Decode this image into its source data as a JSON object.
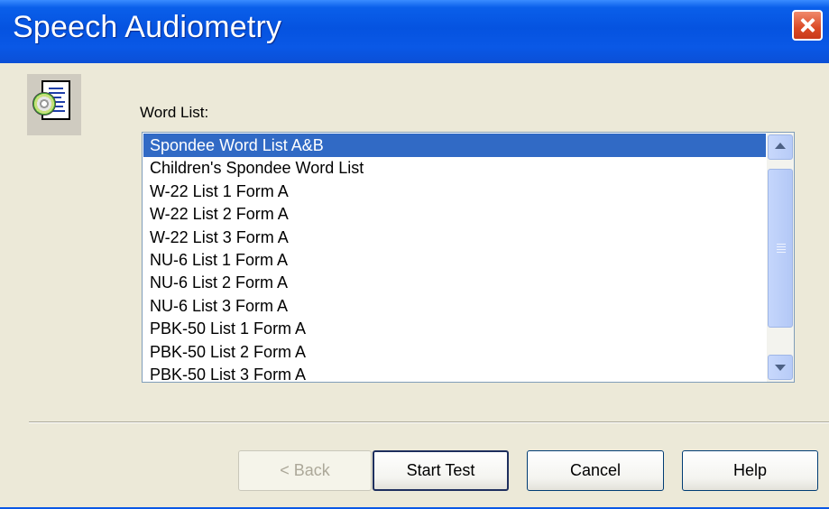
{
  "window": {
    "title": "Speech Audiometry"
  },
  "icons": {
    "dialog_icon": "document-with-disc-icon",
    "close_icon": "close-icon"
  },
  "word_list": {
    "label": "Word List:",
    "selected_index": 0,
    "items": [
      "Spondee Word List A&B",
      "Children's Spondee Word List",
      "W-22 List 1 Form A",
      "W-22 List 2 Form A",
      "W-22 List 3 Form A",
      "NU-6 List 1 Form A",
      "NU-6 List 2 Form A",
      "NU-6 List 3 Form A",
      "PBK-50 List 1 Form A",
      "PBK-50 List 2 Form A",
      "PBK-50 List 3 Form A"
    ]
  },
  "buttons": {
    "back": "< Back",
    "start_test": "Start Test",
    "cancel": "Cancel",
    "help": "Help"
  },
  "colors": {
    "selection": "#316AC5",
    "titlebar": "#0553E0",
    "close": "#DA4A26"
  }
}
